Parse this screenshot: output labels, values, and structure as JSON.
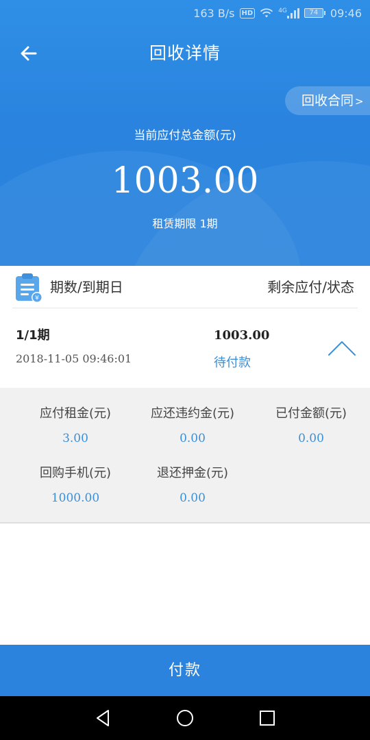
{
  "status_bar": {
    "speed": "163 B/s",
    "hd_badge": "HD",
    "network": "4G",
    "battery": "74",
    "time": "09:46",
    "icons": [
      "wifi-icon",
      "signal-icon",
      "battery-icon"
    ]
  },
  "header": {
    "back_icon": "arrow-left-icon",
    "title": "回收详情",
    "contract_button": "回收合同",
    "contract_chevron": ">",
    "total_label": "当前应付总金额(元)",
    "total_amount": "1003.00",
    "lease_term": "租赁期限 1期"
  },
  "table_header": {
    "icon": "clipboard-yen-icon",
    "left_label": "期数/到期日",
    "right_label": "剩余应付/状态"
  },
  "period": {
    "name": "1/1期",
    "date": "2018-11-05 09:46:01",
    "amount": "1003.00",
    "status": "待付款",
    "toggle_icon": "chevron-up-icon"
  },
  "details": {
    "rent": {
      "label": "应付租金(元)",
      "value": "3.00"
    },
    "penalty": {
      "label": "应还违约金(元)",
      "value": "0.00"
    },
    "paid": {
      "label": "已付金额(元)",
      "value": "0.00"
    },
    "buyback": {
      "label": "回购手机(元)",
      "value": "1000.00"
    },
    "deposit_refund": {
      "label": "退还押金(元)",
      "value": "0.00"
    }
  },
  "pay_button": "付款",
  "nav": [
    "back-triangle-icon",
    "home-circle-icon",
    "recents-square-icon"
  ],
  "colors": {
    "primary": "#2b83dd",
    "value_blue": "#3a8fd9",
    "panel_bg": "#f1f1f1"
  }
}
